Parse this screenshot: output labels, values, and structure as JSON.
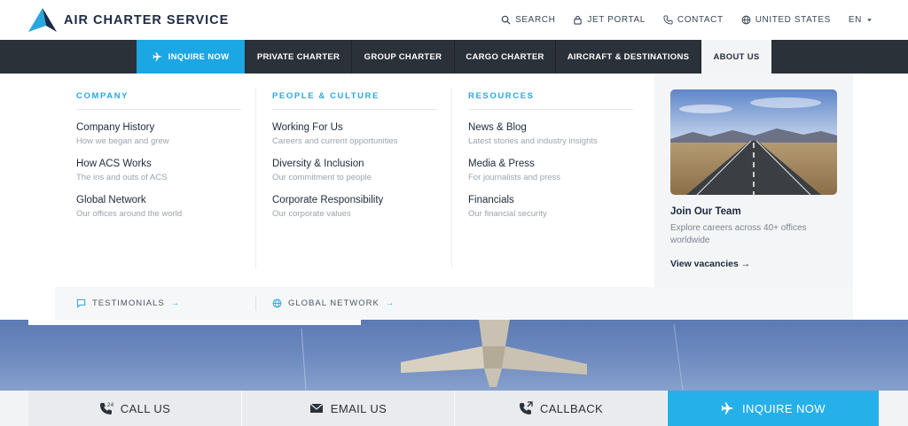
{
  "brand": {
    "name": "AIR CHARTER SERVICE"
  },
  "utility": {
    "search": "SEARCH",
    "jet_portal": "JET PORTAL",
    "contact": "CONTACT",
    "region": "UNITED STATES",
    "language": "EN"
  },
  "nav": {
    "inquire": "INQUIRE NOW",
    "items": [
      "PRIVATE CHARTER",
      "GROUP CHARTER",
      "CARGO CHARTER",
      "AIRCRAFT & DESTINATIONS",
      "ABOUT US"
    ]
  },
  "mega": {
    "columns": [
      {
        "heading": "COMPANY",
        "links": [
          {
            "title": "Company History",
            "sub": "How we began and grew"
          },
          {
            "title": "How ACS Works",
            "sub": "The ins and outs of ACS"
          },
          {
            "title": "Global Network",
            "sub": "Our offices around the world"
          }
        ]
      },
      {
        "heading": "PEOPLE & CULTURE",
        "links": [
          {
            "title": "Working For Us",
            "sub": "Careers and current opportunities"
          },
          {
            "title": "Diversity & Inclusion",
            "sub": "Our commitment to people"
          },
          {
            "title": "Corporate Responsibility",
            "sub": "Our corporate values"
          }
        ]
      },
      {
        "heading": "RESOURCES",
        "links": [
          {
            "title": "News & Blog",
            "sub": "Latest stories and industry insights"
          },
          {
            "title": "Media & Press",
            "sub": "For journalists and press"
          },
          {
            "title": "Financials",
            "sub": "Our financial security"
          }
        ]
      }
    ],
    "feature": {
      "title": "Join Our Team",
      "desc": "Explore careers across 40+ offices worldwide",
      "link": "View vacancies →"
    },
    "strip": {
      "testimonials": "TESTIMONIALS",
      "global": "GLOBAL NETWORK",
      "arrow": "→"
    }
  },
  "bottom_bar": {
    "call": "CALL US",
    "call_badge": "24",
    "email": "EMAIL US",
    "callback": "CALLBACK",
    "inquire": "INQUIRE NOW"
  },
  "colors": {
    "accent": "#1ba6e4",
    "nav_bg": "#2b3139",
    "heading": "#2aa7e0"
  }
}
